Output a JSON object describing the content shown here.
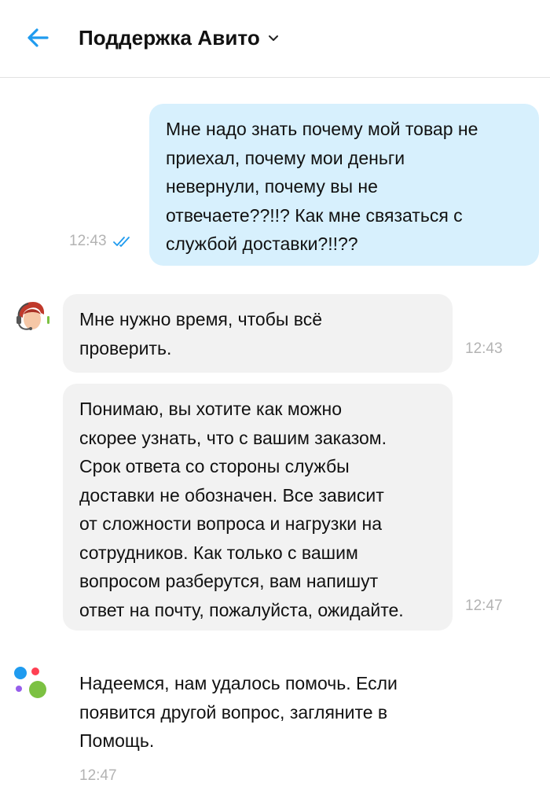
{
  "header": {
    "title": "Поддержка Авито",
    "back_icon": "arrow-left-icon",
    "chevron_icon": "chevron-down-icon",
    "accent": "#1f9bef"
  },
  "messages": [
    {
      "direction": "out",
      "text": "Мне надо знать почему мой товар не\nприехал, почему мои деньги\nневернули, почему вы не\nотвечаете??!!? Как мне связаться с\nслужбой доставки?!!??",
      "time": "12:43",
      "status_icon": "double-check-icon"
    },
    {
      "direction": "in",
      "sender": "support",
      "avatar_icon": "support-agent-icon",
      "text": "Мне нужно время, чтобы всё\nпроверить.",
      "time": "12:43"
    },
    {
      "direction": "in",
      "sender": "support",
      "text": "Понимаю, вы хотите как можно\nскорее узнать, что с вашим заказом.\nСрок ответа со стороны службы\nдоставки не обозначен. Все зависит\nот сложности вопроса и нагрузки на\nсотрудников. Как только с вашим\nвопросом разберутся, вам напишут\nответ на почту, пожалуйста, ожидайте.",
      "time": "12:47"
    },
    {
      "direction": "in",
      "sender": "avito-bot",
      "avatar_icon": "avito-logo-icon",
      "text": "Надеемся, нам удалось помочь. Если\nпоявится другой вопрос, загляните в\nПомощь.",
      "time": "12:47"
    }
  ],
  "colors": {
    "outgoing_bubble": "#d7f0fd",
    "incoming_bubble": "#f2f2f2",
    "timestamp": "#b3b3b3",
    "read_check": "#1f9bef"
  }
}
